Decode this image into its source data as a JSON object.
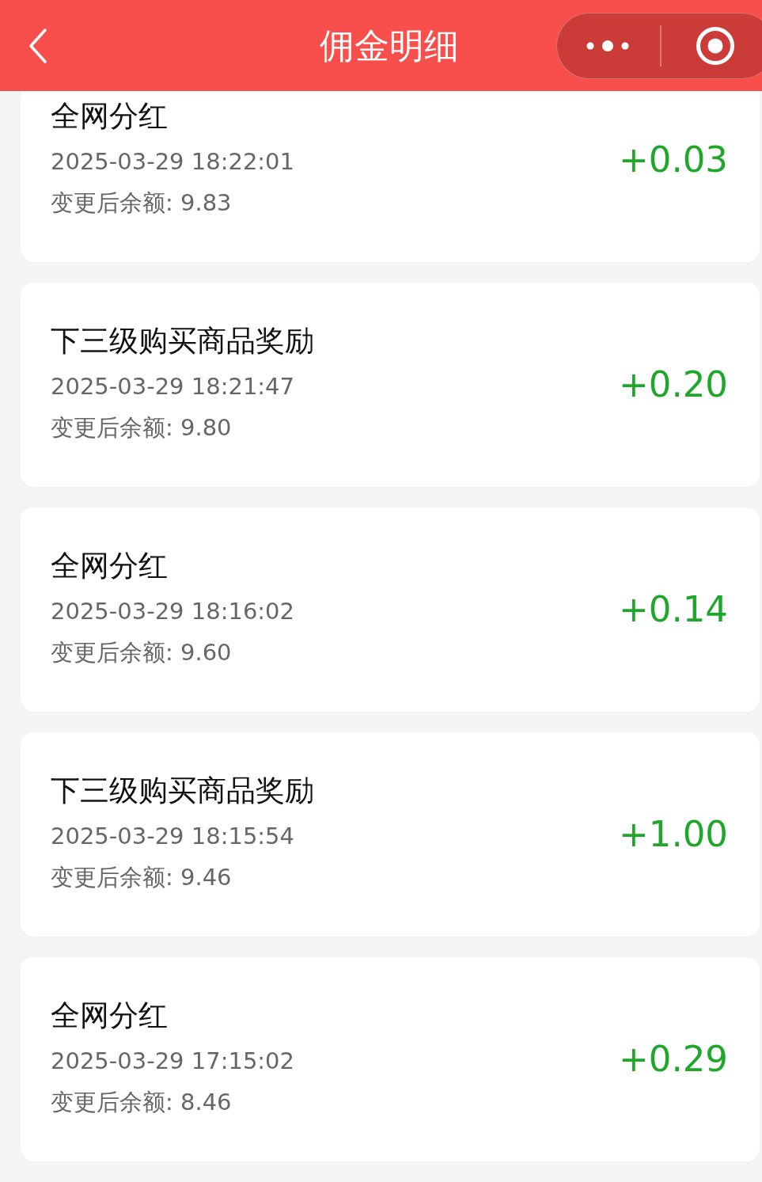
{
  "header": {
    "title": "佣金明细"
  },
  "records": [
    {
      "title": "全网分红",
      "time": "2025-03-29 18:22:01",
      "balance": "变更后余额: 9.83",
      "amount": "+0.03"
    },
    {
      "title": "下三级购买商品奖励",
      "time": "2025-03-29 18:21:47",
      "balance": "变更后余额: 9.80",
      "amount": "+0.20"
    },
    {
      "title": "全网分红",
      "time": "2025-03-29 18:16:02",
      "balance": "变更后余额: 9.60",
      "amount": "+0.14"
    },
    {
      "title": "下三级购买商品奖励",
      "time": "2025-03-29 18:15:54",
      "balance": "变更后余额: 9.46",
      "amount": "+1.00"
    },
    {
      "title": "全网分红",
      "time": "2025-03-29 17:15:02",
      "balance": "变更后余额: 8.46",
      "amount": "+0.29"
    }
  ]
}
